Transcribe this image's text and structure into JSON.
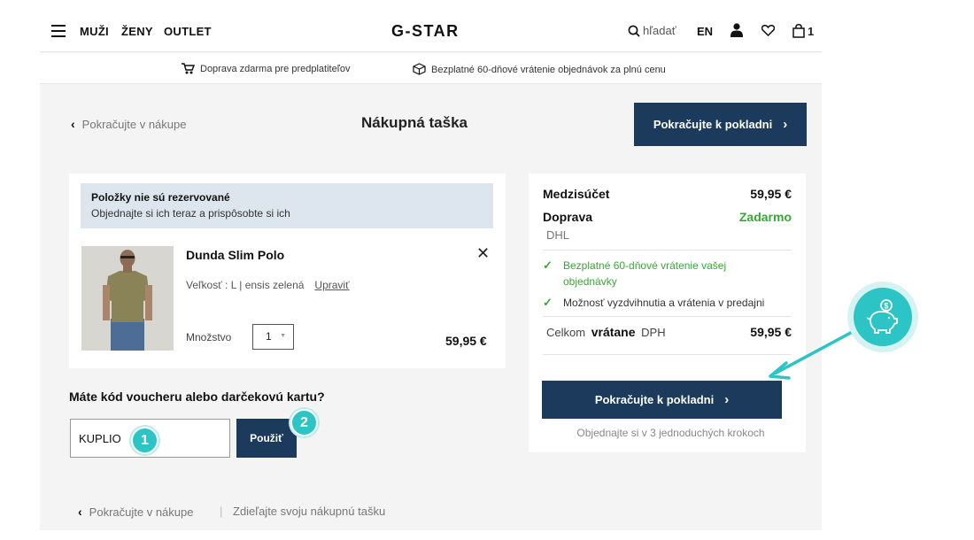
{
  "header": {
    "nav": [
      "MUŽI",
      "ŽENY",
      "OUTLET"
    ],
    "logo": "G-STAR",
    "search_label": "hľadať",
    "lang": "EN",
    "bag_count": "1"
  },
  "usp": {
    "shipping": "Doprava zdarma pre predplatiteľov",
    "returns": "Bezplatné 60-dňové vrátenie objednávok za plnú cenu"
  },
  "title_row": {
    "back": "Pokračujte v nákupe",
    "title": "Nákupná taška",
    "checkout": "Pokračujte k pokladni"
  },
  "cart": {
    "notice_title": "Položky nie sú rezervované",
    "notice_text": "Objednajte si ich teraz a prispôsobte si ich",
    "item": {
      "name": "Dunda Slim Polo",
      "size_text": "Veľkosť : L | ensis zelená",
      "edit": "Upraviť",
      "qty_label": "Množstvo",
      "qty_value": "1",
      "price": "59,95 €"
    }
  },
  "voucher": {
    "title": "Máte kód voucheru alebo darčekovú kartu?",
    "code": "KUPLIO",
    "apply": "Použiť",
    "badge1": "1",
    "badge2": "2"
  },
  "summary": {
    "subtotal_label": "Medzisúčet",
    "subtotal_value": "59,95 €",
    "shipping_label": "Doprava",
    "shipping_value": "Zadarmo",
    "carrier": "DHL",
    "benefit1": "Bezplatné 60-dňové vrátenie vašej objednávky",
    "benefit2": "Možnosť vyzdvihnutia a vrátenia v predajni",
    "total_prefix": "Celkom",
    "total_strong": "vrátane",
    "total_suffix": "DPH",
    "total_value": "59,95 €",
    "checkout": "Pokračujte k pokladni",
    "steps_note": "Objednajte si v 3 jednoduchých krokoch"
  },
  "footer": {
    "back": "Pokračujte v nákupe",
    "separator": "|",
    "share": "Zdieľajte svoju nákupnú tašku"
  },
  "colors": {
    "primary": "#1b3a5c",
    "accent": "#2cc4c4",
    "success": "#3aa637"
  },
  "icons": [
    "menu-icon",
    "search-icon",
    "user-icon",
    "heart-icon",
    "bag-icon",
    "truck-icon",
    "box-icon",
    "close-icon",
    "check-icon",
    "chevron-left-icon",
    "chevron-right-icon",
    "piggy-bank-icon"
  ]
}
